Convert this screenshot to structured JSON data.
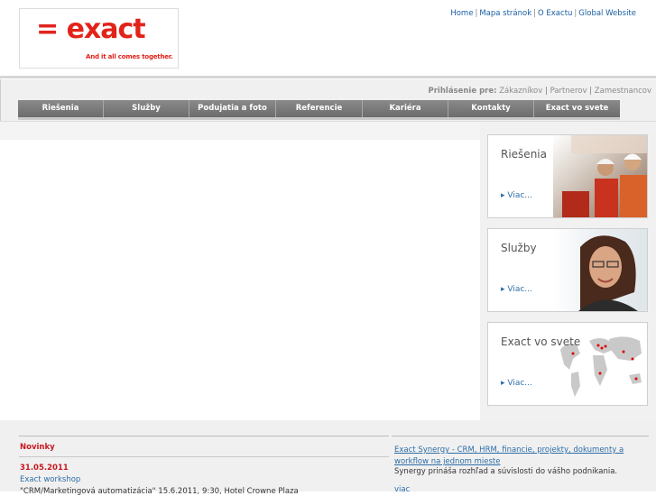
{
  "brand": {
    "logo_text": "= exact",
    "tagline": "And it all comes together.",
    "color": "#e2231a"
  },
  "toplinks": [
    "Home",
    "Mapa stránok",
    "O Exactu",
    "Global Website"
  ],
  "login": {
    "label": "Prihlásenie pre:",
    "links": [
      "Zákazníkov",
      "Partnerov",
      "Zamestnancov"
    ]
  },
  "nav": [
    {
      "label": "Riešenia",
      "w": 95
    },
    {
      "label": "Služby",
      "w": 95
    },
    {
      "label": "Podujatia a foto",
      "w": 96
    },
    {
      "label": "Referencie",
      "w": 96
    },
    {
      "label": "Kariéra",
      "w": 95
    },
    {
      "label": "Kontakty",
      "w": 95
    },
    {
      "label": "Exact vo svete",
      "w": 95
    }
  ],
  "cards": [
    {
      "title": "Riešenia",
      "more": "▸ Viac..."
    },
    {
      "title": "Služby",
      "more": "▸ Viac..."
    },
    {
      "title": "Exact vo svete",
      "more": "▸ Viac..."
    }
  ],
  "news": {
    "title": "Novinky",
    "date": "31.05.2011",
    "link": "Exact workshop",
    "snippet": "\"CRM/Marketingová automatizácia\" 15.6.2011, 9:30, Hotel Crowne Plaza"
  },
  "promo": {
    "title": "Exact Synergy - CRM, HRM, financie, projekty, dokumenty a workflow na jednom mieste",
    "text": "Synergy prináša rozhľad a súvislosti do vášho podnikania.",
    "more": "viac"
  }
}
